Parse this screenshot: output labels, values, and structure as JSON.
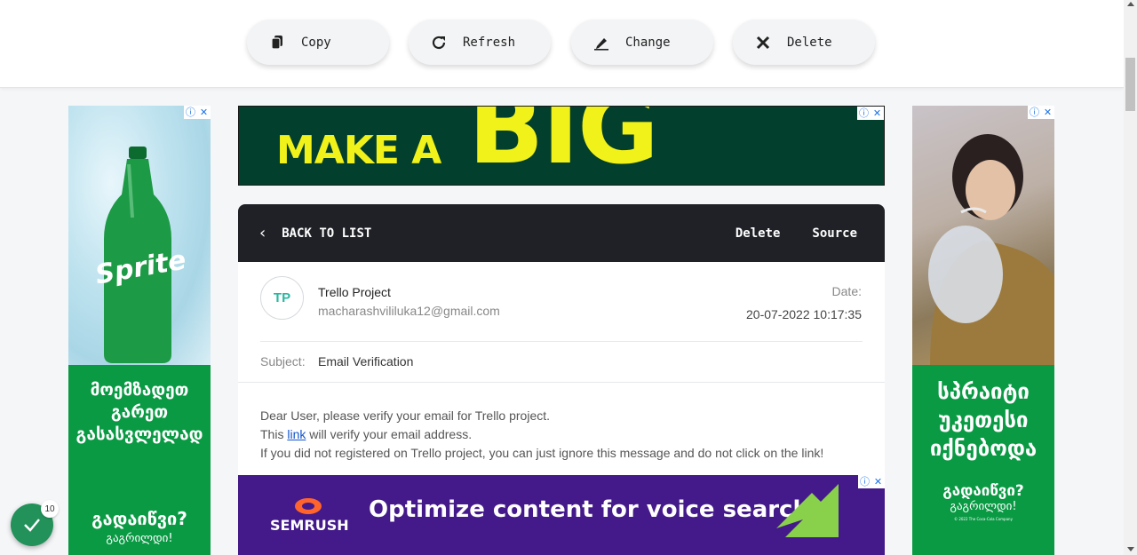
{
  "toolbar": {
    "copy_label": "Copy",
    "refresh_label": "Refresh",
    "change_label": "Change",
    "delete_label": "Delete"
  },
  "ads": {
    "info_icon": "ⓘ",
    "close_icon": "✕",
    "top_banner": {
      "line1": "MAKE A",
      "line2": "BIG"
    },
    "left": {
      "brand": "Sprite",
      "line1": "მოემზადეთ",
      "line2": "გარეთ",
      "line3": "გასასვლელად",
      "question": "გადაიწვი?",
      "answer": "გაგრილდი!"
    },
    "right": {
      "line1": "სპრაიტი",
      "line2": "უკეთესი",
      "line3": "იქნებოდა",
      "question": "გადაიწვი?",
      "answer": "გაგრილდი!",
      "fine_print": "© 2022 The Coca-Cola Company"
    },
    "bottom": {
      "brand": "SEMRUSH",
      "headline": "Optimize content for voice search"
    }
  },
  "mail": {
    "back_label": "BACK TO LIST",
    "delete_label": "Delete",
    "source_label": "Source",
    "avatar_initials": "TP",
    "sender_name": "Trello Project",
    "sender_email": "macharashvililuka12@gmail.com",
    "date_label": "Date:",
    "date_value": "20-07-2022 10:17:35",
    "subject_label": "Subject:",
    "subject_value": "Email Verification",
    "body_line1": "Dear User, please verify your email for Trello project.",
    "body_line2_pre": "This ",
    "body_link": "link",
    "body_line2_post": " will verify your email address.",
    "body_line3": "If you did not registered on Trello project, you can just ignore this message and do not click on the link!"
  },
  "fab": {
    "count": "10"
  },
  "colors": {
    "accent": "#2ab79f",
    "header_dark": "#1f2126",
    "fab_green": "#22915a"
  }
}
